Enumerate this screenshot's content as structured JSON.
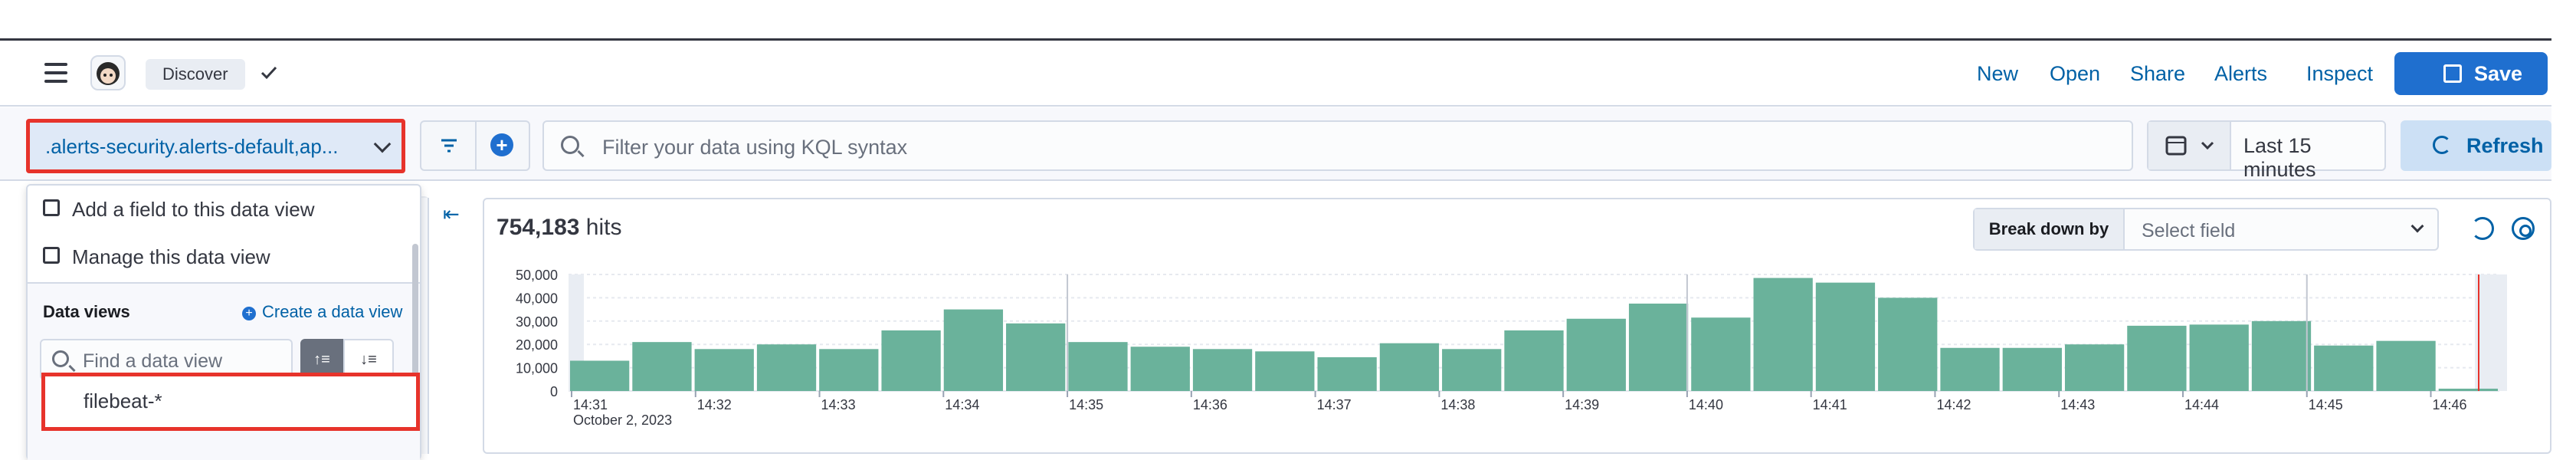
{
  "header": {
    "breadcrumb": "Discover",
    "links": [
      "New",
      "Open",
      "Share",
      "Alerts",
      "Inspect"
    ],
    "save_label": "Save"
  },
  "query_bar": {
    "data_view": ".alerts-security.alerts-default,ap...",
    "kql_placeholder": "Filter your data using KQL syntax",
    "time_range": "Last 15 minutes",
    "refresh_label": "Refresh"
  },
  "data_view_popover": {
    "actions": [
      "Add a field to this data view",
      "Manage this data view"
    ],
    "section_title": "Data views",
    "create_label": "Create a data view",
    "find_placeholder": "Find a data view",
    "items": [
      "filebeat-*"
    ]
  },
  "results": {
    "hits_count": "754,183",
    "hits_label": "hits",
    "breakdown_label": "Break down by",
    "breakdown_placeholder": "Select field"
  },
  "colors": {
    "bar": "#6ab29b",
    "accent": "#1f6fcf",
    "highlight": "#e7332b"
  },
  "chart_data": {
    "type": "bar",
    "ylim": [
      0,
      50000
    ],
    "yticks": [
      "50,000",
      "40,000",
      "30,000",
      "20,000",
      "10,000",
      "0"
    ],
    "ytick_values": [
      50000,
      40000,
      30000,
      20000,
      10000,
      0
    ],
    "xticks": [
      "14:31",
      "14:32",
      "14:33",
      "14:34",
      "14:35",
      "14:36",
      "14:37",
      "14:38",
      "14:39",
      "14:40",
      "14:41",
      "14:42",
      "14:43",
      "14:44",
      "14:45",
      "14:46"
    ],
    "date_label": "October 2, 2023",
    "values": [
      13000,
      21000,
      18000,
      20000,
      18000,
      26000,
      35000,
      29000,
      21000,
      19000,
      18000,
      17000,
      14500,
      20500,
      18000,
      26000,
      31000,
      37500,
      31500,
      48500,
      46500,
      40000,
      18500,
      18500,
      20000,
      28000,
      28500,
      30000,
      19500,
      21500,
      1000
    ],
    "grid": true
  }
}
